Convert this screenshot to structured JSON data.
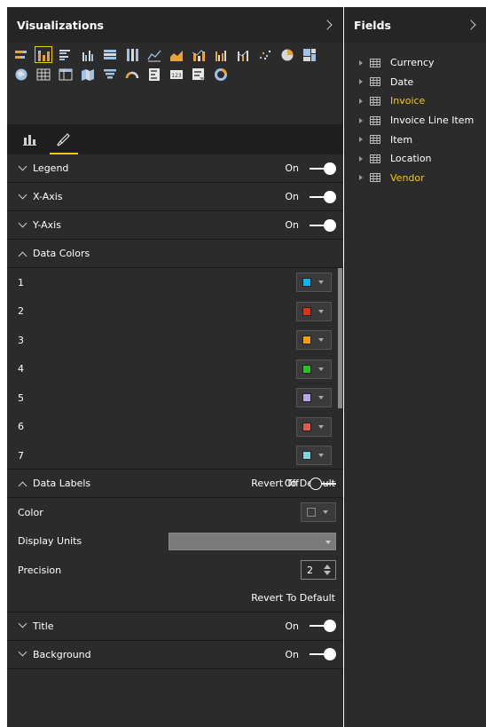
{
  "visualizations": {
    "title": "Visualizations",
    "icons_row1": [
      "stacked-bar-chart-icon",
      "stacked-column-chart-icon",
      "clustered-bar-chart-icon",
      "clustered-column-chart-icon",
      "100-stacked-bar-chart-icon",
      "100-stacked-column-chart-icon",
      "line-chart-icon",
      "area-chart-icon",
      "line-stacked-column-chart-icon",
      "line-clustered-column-chart-icon",
      "ribbon-chart-icon",
      "scatter-chart-icon",
      "pie-chart-icon",
      "treemap-icon"
    ],
    "icons_row2": [
      "map-icon",
      "table-icon",
      "matrix-icon",
      "filled-map-icon",
      "funnel-icon",
      "gauge-icon",
      "multi-row-card-icon",
      "card-icon",
      "slicer-icon",
      "donut-chart-icon"
    ],
    "tabs": [
      "fields-tab",
      "format-tab"
    ]
  },
  "format": {
    "legend": {
      "label": "Legend",
      "state": "On"
    },
    "xaxis": {
      "label": "X-Axis",
      "state": "On"
    },
    "yaxis": {
      "label": "Y-Axis",
      "state": "On"
    },
    "data_colors": {
      "label": "Data Colors",
      "items": [
        {
          "num": "1",
          "color": "#01b8f0"
        },
        {
          "num": "2",
          "color": "#e0301e"
        },
        {
          "num": "3",
          "color": "#f8a100"
        },
        {
          "num": "4",
          "color": "#29c42b"
        },
        {
          "num": "5",
          "color": "#b9a6e6"
        },
        {
          "num": "6",
          "color": "#e05a4f"
        },
        {
          "num": "7",
          "color": "#7fd6da"
        }
      ],
      "revert": "Revert To Default"
    },
    "data_labels": {
      "label": "Data Labels",
      "state": "Off",
      "color_label": "Color",
      "display_units_label": "Display Units",
      "display_units_value": "",
      "precision_label": "Precision",
      "precision_value": "2",
      "revert": "Revert To Default"
    },
    "title": {
      "label": "Title",
      "state": "On"
    },
    "background": {
      "label": "Background",
      "state": "On"
    }
  },
  "fields": {
    "title": "Fields",
    "items": [
      {
        "label": "Currency",
        "highlight": false
      },
      {
        "label": "Date",
        "highlight": false
      },
      {
        "label": "Invoice",
        "highlight": true
      },
      {
        "label": "Invoice Line Item",
        "highlight": false
      },
      {
        "label": "Item",
        "highlight": false
      },
      {
        "label": "Location",
        "highlight": false
      },
      {
        "label": "Vendor",
        "highlight": true
      }
    ]
  },
  "colors": {
    "accent": "#f2c811",
    "pane_bg": "#2b2b2b"
  }
}
